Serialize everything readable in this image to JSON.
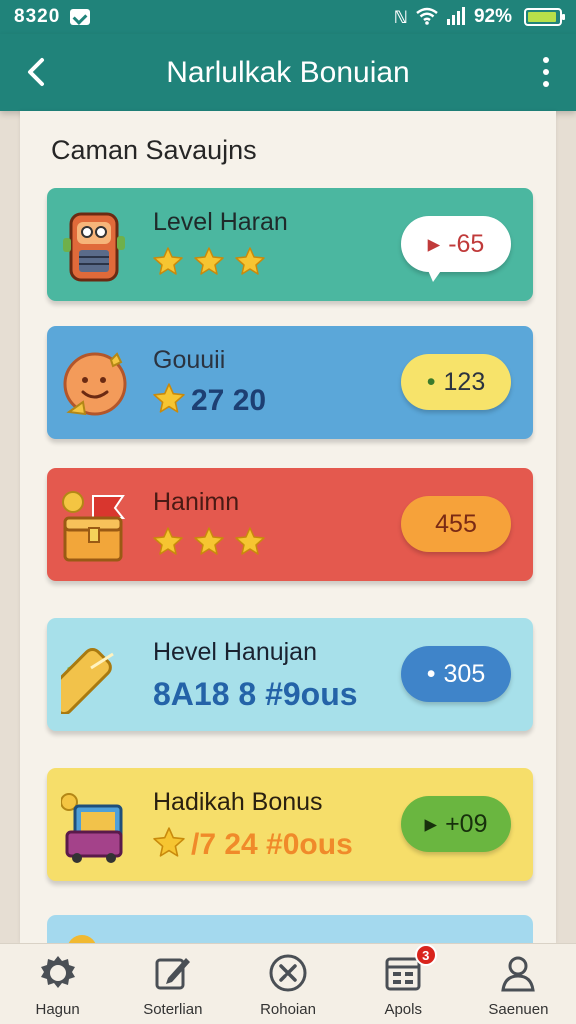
{
  "status_bar": {
    "time": "8320",
    "battery_text": "92%",
    "battery_level": 0.92
  },
  "app_bar": {
    "title": "Narlulkak Bonuian"
  },
  "section": {
    "title": "Caman Savaujns"
  },
  "cards": [
    {
      "title": "Level Haran",
      "sub_text": "",
      "stars": 3,
      "pill_text": "-65",
      "pill_marker": "▸",
      "bg": "#4bb7a0",
      "pill_bg": "#ffffff",
      "pill_color": "#c03a3a",
      "icon": "robot-icon"
    },
    {
      "title": "Gouuii",
      "sub_text": "27 20",
      "stars": 1,
      "pill_text": "123",
      "pill_marker": "•",
      "bg": "#5ba7d9",
      "pill_bg": "#f7e36a",
      "pill_color": "#2b3340",
      "icon": "smiley-icon"
    },
    {
      "title": "Hanimn",
      "sub_text": "",
      "stars": 3,
      "pill_text": "455",
      "pill_marker": "",
      "bg": "#e4594e",
      "pill_bg": "#f6a23a",
      "pill_color": "#7a2a14",
      "icon": "treasure-chest-icon"
    },
    {
      "title": "Hevel Hanujan",
      "sub_text": "8A18 8 #9ous",
      "stars": 0,
      "pill_text": "305",
      "pill_marker": "•",
      "bg": "#a7e0ea",
      "pill_bg": "#3f84c9",
      "pill_color": "#ffffff",
      "icon": "gold-bar-icon"
    },
    {
      "title": "Hadikah Bonus",
      "sub_text": "/7 24 #0ous",
      "stars": 1,
      "pill_text": "+09",
      "pill_marker": "▸",
      "bg": "#f6de6a",
      "pill_bg": "#6ab640",
      "pill_color": "#17300c",
      "icon": "gift-machine-icon"
    }
  ],
  "bottom_nav": {
    "items": [
      {
        "label": "Hagun",
        "icon": "gear-icon"
      },
      {
        "label": "Soterlian",
        "icon": "edit-icon"
      },
      {
        "label": "Rohoian",
        "icon": "emblem-icon"
      },
      {
        "label": "Apols",
        "icon": "calendar-icon",
        "badge": "3"
      },
      {
        "label": "Saenuen",
        "icon": "user-icon"
      }
    ]
  }
}
